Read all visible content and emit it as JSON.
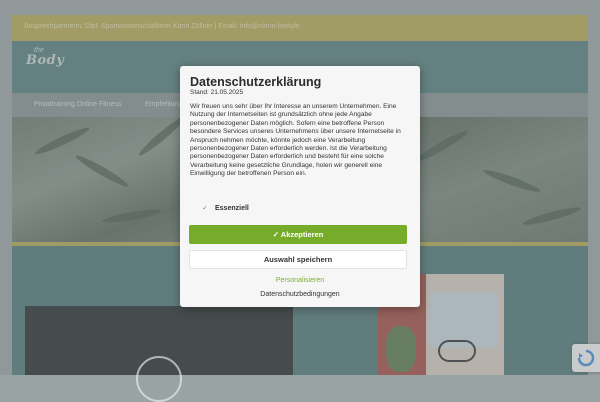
{
  "topbar": {
    "text": "Ansprechpartnerin: Dipl. Sportwissenschaftlerin Karin Zöllner | Email: info@nimm-bestyle"
  },
  "header": {
    "logo_text": "Body",
    "logo_prefix": "the"
  },
  "nav": {
    "items": [
      "Privattraining Online Fitness",
      "Empfehlungen"
    ]
  },
  "modal": {
    "title": "Datenschutzerklärung",
    "date": "Stand: 21.05.2025",
    "text": "Wir freuen uns sehr über Ihr Interesse an unserem Unternehmen. Eine Nutzung der Internetseiten ist grundsätzlich ohne jede Angabe personenbezogener Daten möglich. Sofern eine betroffene Person besondere Services unseres Unternehmens über unsere Internetseite in Anspruch nehmen möchte, könnte jedoch eine Verarbeitung personenbezogener Daten erforderlich werden. Ist die Verarbeitung personenbezogener Daten erforderlich und besteht für eine solche Verarbeitung keine gesetzliche Grundlage, holen wir generell eine Einwilligung der betroffenen Person ein.",
    "consent_label": "Essenziell",
    "consent_checked": true,
    "accept_label": "Akzeptieren",
    "accept_icon": "check-icon",
    "save_label": "Auswahl speichern",
    "personalize_label": "Personalisieren",
    "privacy_label": "Datenschutzbedingungen"
  },
  "colors": {
    "accent_green": "#77ac2a",
    "link_green": "#7fae33",
    "topbar_gold": "#b7ad58",
    "header_teal": "#5a8282"
  },
  "icons": {
    "recaptcha": "recaptcha-icon",
    "play": "video-play-icon"
  }
}
